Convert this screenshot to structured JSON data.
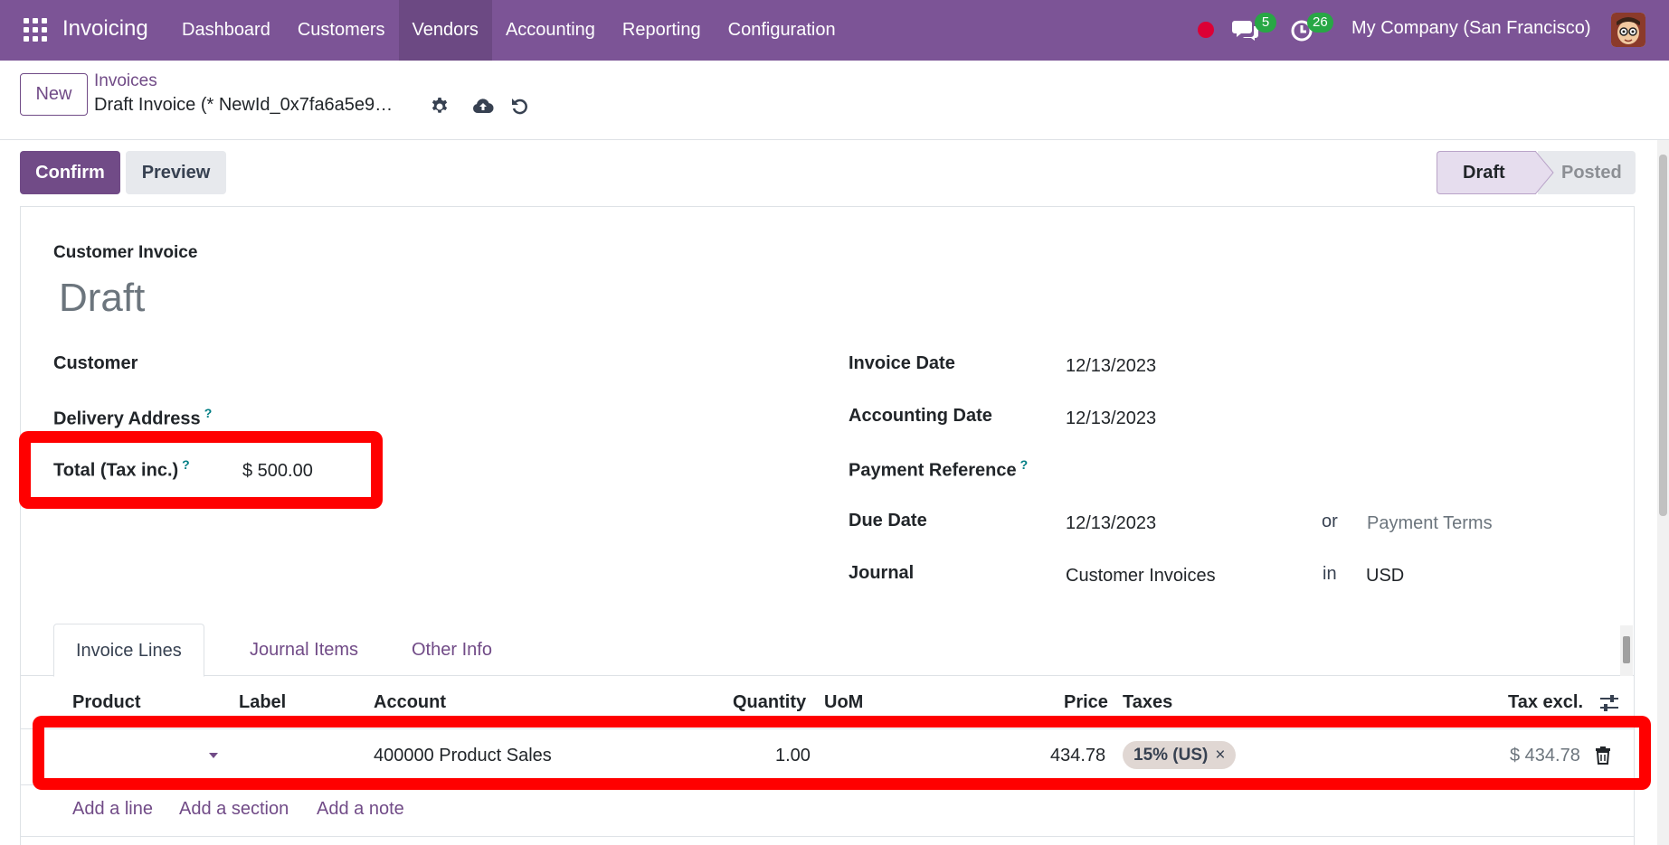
{
  "navbar": {
    "brand": "Invoicing",
    "menu": [
      "Dashboard",
      "Customers",
      "Vendors",
      "Accounting",
      "Reporting",
      "Configuration"
    ],
    "active_menu": "Vendors",
    "messages_count": "5",
    "activities_count": "26",
    "company": "My Company (San Francisco)"
  },
  "control_panel": {
    "new_label": "New",
    "breadcrumb_parent": "Invoices",
    "breadcrumb_current": "Draft Invoice (* NewId_0x7fa6a5e9…"
  },
  "actions": {
    "confirm_label": "Confirm",
    "preview_label": "Preview"
  },
  "statusbar": {
    "draft": "Draft",
    "posted": "Posted"
  },
  "form": {
    "move_type": "Customer Invoice",
    "title": "Draft",
    "customer_label": "Customer",
    "delivery_address_label": "Delivery Address",
    "total_label": "Total (Tax inc.)",
    "total_value": "$ 500.00",
    "invoice_date_label": "Invoice Date",
    "invoice_date": "12/13/2023",
    "accounting_date_label": "Accounting Date",
    "accounting_date": "12/13/2023",
    "payment_reference_label": "Payment Reference",
    "due_date_label": "Due Date",
    "due_date": "12/13/2023",
    "or_label": "or",
    "payment_terms_placeholder": "Payment Terms",
    "journal_label": "Journal",
    "journal": "Customer Invoices",
    "in_label": "in",
    "currency": "USD",
    "help_mark": "?"
  },
  "tabs": [
    "Invoice Lines",
    "Journal Items",
    "Other Info"
  ],
  "lines": {
    "headers": {
      "product": "Product",
      "label": "Label",
      "account": "Account",
      "quantity": "Quantity",
      "uom": "UoM",
      "price": "Price",
      "taxes": "Taxes",
      "tax_excl": "Tax excl."
    },
    "row": {
      "account": "400000 Product Sales",
      "quantity": "1.00",
      "price": "434.78",
      "tax": "15% (US)",
      "tax_remove": "×",
      "subtotal": "$ 434.78"
    },
    "add_line": "Add a line",
    "add_section": "Add a section",
    "add_note": "Add a note"
  },
  "colors": {
    "brand": "#714b87",
    "navbar": "#7c5496",
    "highlight": "#ff0000"
  }
}
